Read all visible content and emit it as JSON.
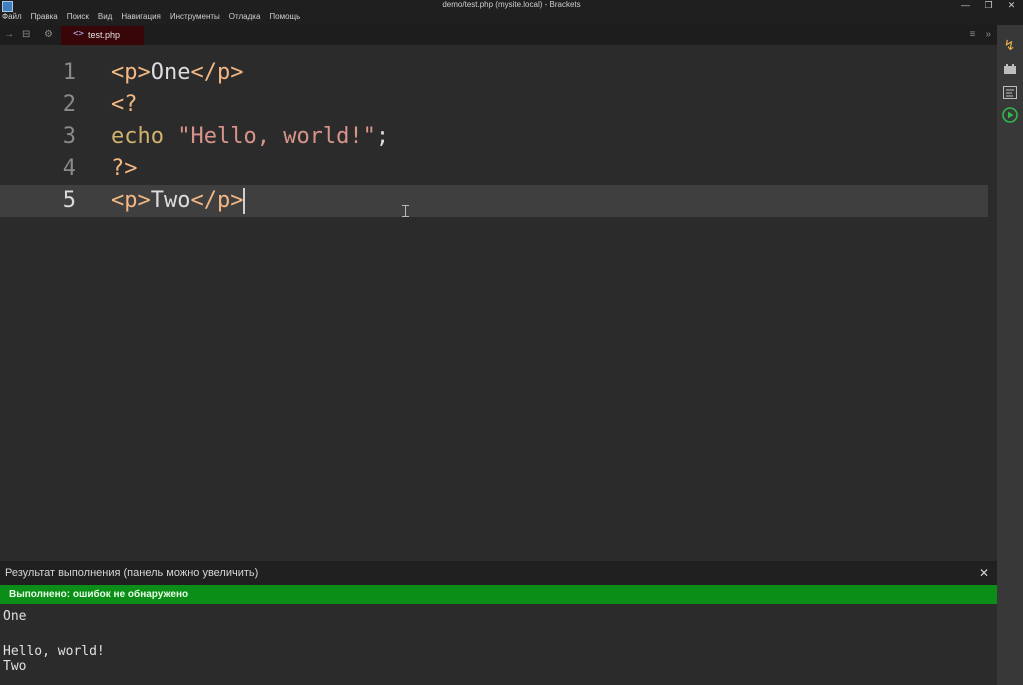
{
  "window": {
    "title": "demo/test.php (mysite.local) - Brackets"
  },
  "menu": [
    "Файл",
    "Правка",
    "Поиск",
    "Вид",
    "Навигация",
    "Инструменты",
    "Отладка",
    "Помощь"
  ],
  "tab": {
    "label": "test.php",
    "icon": "code-icon"
  },
  "editor": {
    "lines": [
      {
        "number": "1",
        "tokens": [
          [
            "tag",
            "<p>"
          ],
          [
            "plain",
            "One"
          ],
          [
            "tag",
            "</p>"
          ]
        ]
      },
      {
        "number": "2",
        "tokens": [
          [
            "tag",
            "<?"
          ]
        ]
      },
      {
        "number": "3",
        "tokens": [
          [
            "kw",
            "echo "
          ],
          [
            "str",
            "\"Hello, world!\""
          ],
          [
            "plain",
            ";"
          ]
        ]
      },
      {
        "number": "4",
        "tokens": [
          [
            "tag",
            "?>"
          ]
        ]
      },
      {
        "number": "5",
        "tokens": [
          [
            "tag",
            "<p>"
          ],
          [
            "plain",
            "Two"
          ],
          [
            "tag",
            "</p>"
          ]
        ]
      }
    ],
    "active_line": "5"
  },
  "panel": {
    "title": "Результат выполнения (панель можно увеличить)",
    "status": "Выполнено: ошибок не обнаружено",
    "status_color": "#0b8e17",
    "output": [
      "One",
      "",
      "Hello, world!",
      "Two"
    ]
  },
  "colors": {
    "tag": "#f4b783",
    "keyword": "#d2b36e",
    "string": "#d8948b",
    "tab_bg": "#380609"
  }
}
